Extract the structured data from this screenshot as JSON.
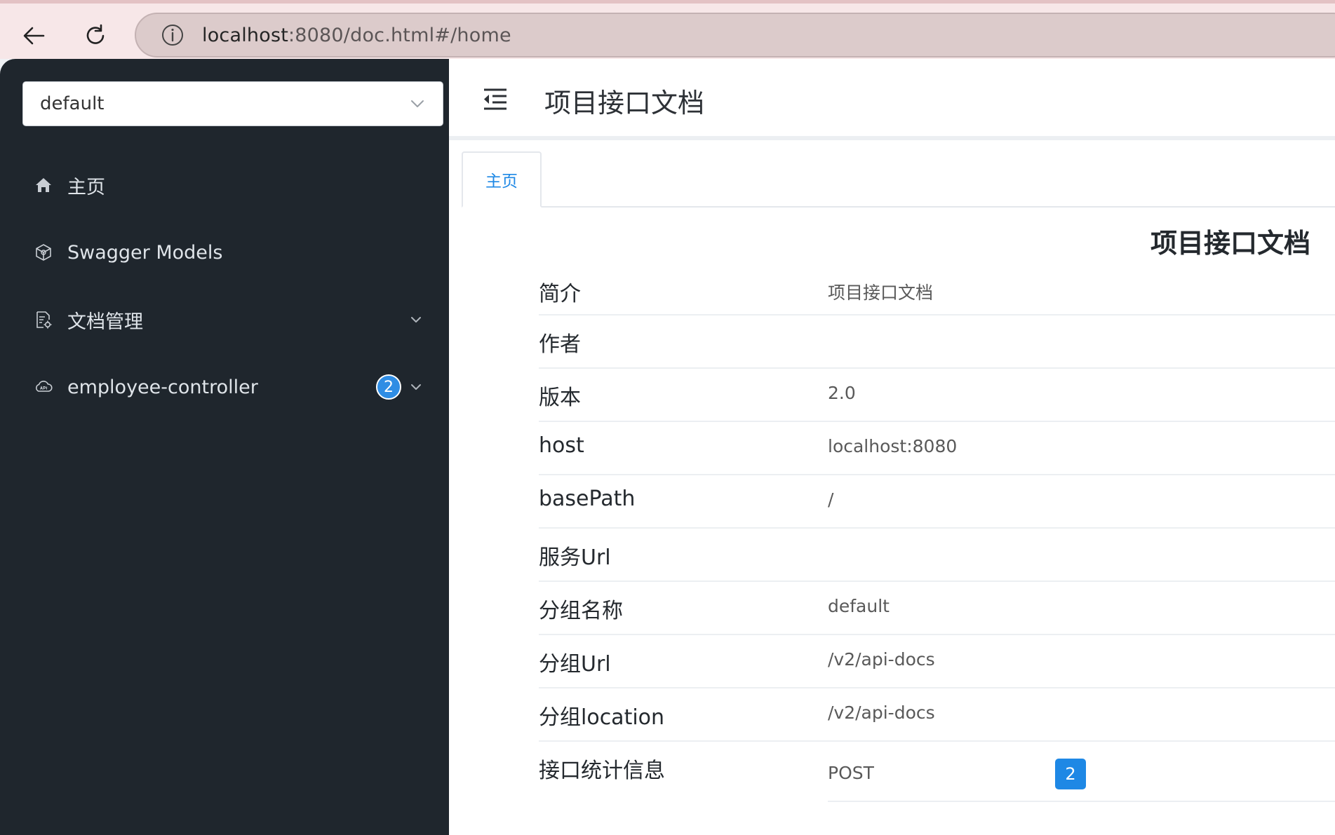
{
  "browser": {
    "url_host": "localhost",
    "url_rest": ":8080/doc.html#/home"
  },
  "sidebar": {
    "group_select": {
      "value": "default"
    },
    "items": [
      {
        "label": "主页",
        "icon": "home-icon"
      },
      {
        "label": "Swagger Models",
        "icon": "cube-icon"
      },
      {
        "label": "文档管理",
        "icon": "document-settings-icon",
        "expandable": true
      },
      {
        "label": "employee-controller",
        "icon": "api-cloud-icon",
        "badge": "2",
        "expandable": true
      }
    ]
  },
  "header": {
    "title": "项目接口文档"
  },
  "tabs": [
    {
      "label": "主页",
      "active": true
    }
  ],
  "doc": {
    "title": "项目接口文档",
    "rows": [
      {
        "key": "简介",
        "value": "项目接口文档"
      },
      {
        "key": "作者",
        "value": ""
      },
      {
        "key": "版本",
        "value": "2.0"
      },
      {
        "key": "host",
        "value": "localhost:8080"
      },
      {
        "key": "basePath",
        "value": "/"
      },
      {
        "key": "服务Url",
        "value": ""
      },
      {
        "key": "分组名称",
        "value": "default"
      },
      {
        "key": "分组Url",
        "value": "/v2/api-docs"
      },
      {
        "key": "分组location",
        "value": "/v2/api-docs"
      }
    ],
    "stats": {
      "key": "接口统计信息",
      "method": "POST",
      "count": "2"
    }
  },
  "colors": {
    "sidebar_bg": "#1f262d",
    "accent": "#1e88e5",
    "badge": "#2f8de4"
  }
}
